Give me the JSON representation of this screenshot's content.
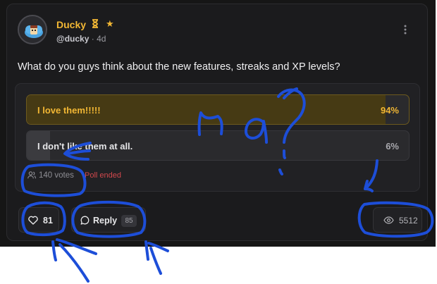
{
  "post": {
    "author_name": "Ducky",
    "handle": "@ducky",
    "time": "· 4d",
    "question": "What do you guys think about the new features, streaks and XP levels?",
    "more_icon": "kebab-menu-icon"
  },
  "poll": {
    "options": [
      {
        "label": "I love them!!!!!",
        "percent_text": "94%",
        "percent": 94
      },
      {
        "label": "I don't like them at all.",
        "percent_text": "6%",
        "percent": 6
      }
    ],
    "votes": "140 votes",
    "status": "Poll ended"
  },
  "actions": {
    "likes": "81",
    "reply_label": "Reply",
    "reply_count": "85",
    "views": "5512"
  },
  "annotations": {
    "handwritten_text": "na?"
  },
  "colors": {
    "accent": "#f2b734",
    "card": "#1b1b1d",
    "ended": "#d0484c",
    "ink": "#1d4ed8"
  }
}
